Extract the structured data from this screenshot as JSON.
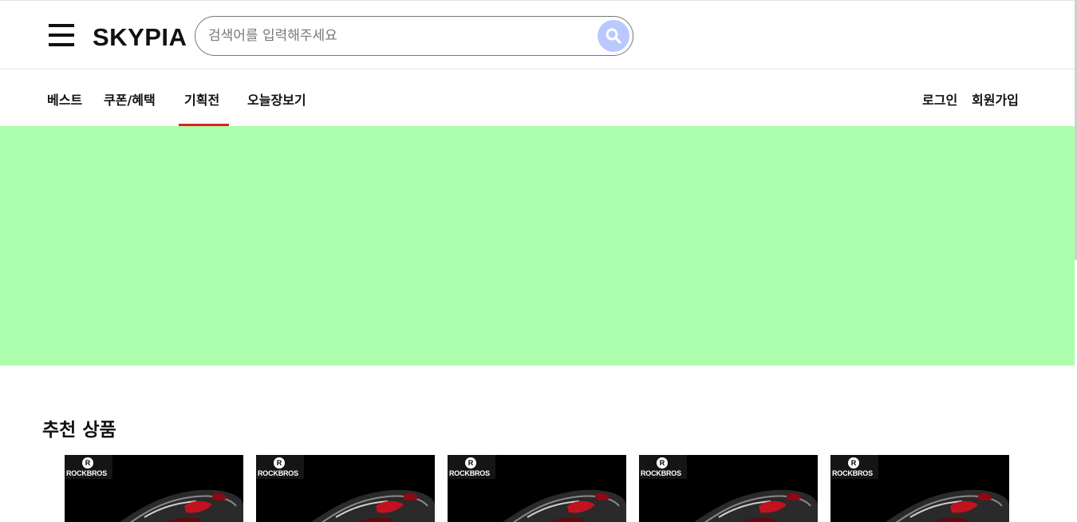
{
  "header": {
    "logo": "SKYPIA",
    "search_placeholder": "검색어를 입력해주세요"
  },
  "nav": {
    "items": [
      "베스트",
      "쿠폰/혜택",
      "기획전",
      "오늘장보기"
    ],
    "active_index": 2,
    "login": "로그인",
    "signup": "회원가입"
  },
  "colors": {
    "banner": "#acffac",
    "active_underline": "#e02020",
    "search_button": "#b9c8ff"
  },
  "recommended": {
    "title": "추천 상품",
    "products": [
      {
        "brand": "ROCKBROS",
        "brand_icon": "R"
      },
      {
        "brand": "ROCKBROS",
        "brand_icon": "R"
      },
      {
        "brand": "ROCKBROS",
        "brand_icon": "R"
      },
      {
        "brand": "ROCKBROS",
        "brand_icon": "R"
      },
      {
        "brand": "ROCKBROS",
        "brand_icon": "R"
      }
    ]
  }
}
